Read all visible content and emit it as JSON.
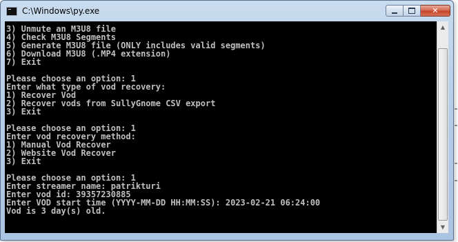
{
  "window": {
    "title": "C:\\Windows\\py.exe",
    "icon": "console-app-icon",
    "controls": {
      "minimize_icon": "minimize-icon",
      "maximize_icon": "maximize-icon",
      "close_glyph": "✕"
    }
  },
  "console": {
    "lines": [
      "3) Unmute an M3U8 file",
      "4) Check M3U8 Segments",
      "5) Generate M3U8 file (ONLY includes valid segments)",
      "6) Download M3U8 (.MP4 extension)",
      "7) Exit",
      "",
      "Please choose an option: 1",
      "Enter what type of vod recovery:",
      "1) Recover Vod",
      "2) Recover vods from SullyGnome CSV export",
      "3) Exit",
      "",
      "Please choose an option: 1",
      "Enter vod recovery method:",
      "1) Manual Vod Recover",
      "2) Website Vod Recover",
      "3) Exit",
      "",
      "Please choose an option: 1",
      "Enter streamer name: patrikturi",
      "Enter vod id: 39357230885",
      "Enter VOD start time (YYYY-MM-DD HH:MM:SS): 2023-02-21 06:24:00",
      "Vod is 3 day(s) old."
    ],
    "foreground_color": "#c0c0c0",
    "background_color": "#000000"
  },
  "scrollbar": {
    "up_arrow": "▲",
    "down_arrow": "▼",
    "position": 1.0
  }
}
